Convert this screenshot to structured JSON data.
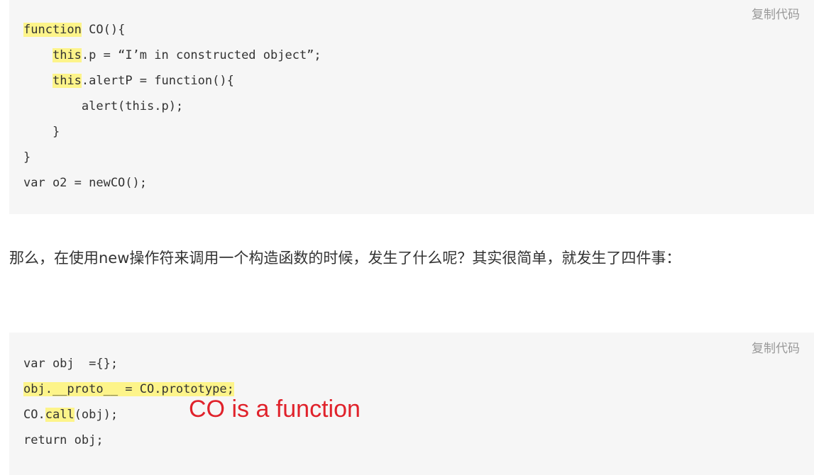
{
  "colors": {
    "highlight": "#fdf48a",
    "code_bg": "#f6f6f6",
    "annotation": "#e0222b",
    "copy_text": "#999999"
  },
  "block1": {
    "copy_label": "复制代码",
    "lines": [
      {
        "parts": [
          {
            "text": "function",
            "hl": true
          },
          {
            "text": " CO(){",
            "hl": false
          }
        ]
      },
      {
        "parts": [
          {
            "text": "    ",
            "hl": false
          },
          {
            "text": "this",
            "hl": true
          },
          {
            "text": ".p = “I’m in constructed object”;",
            "hl": false
          }
        ]
      },
      {
        "parts": [
          {
            "text": "    ",
            "hl": false
          },
          {
            "text": "this",
            "hl": true
          },
          {
            "text": ".alertP = function(){",
            "hl": false
          }
        ]
      },
      {
        "parts": [
          {
            "text": "        alert(this.p);",
            "hl": false
          }
        ]
      },
      {
        "parts": [
          {
            "text": "    }",
            "hl": false
          }
        ]
      },
      {
        "parts": [
          {
            "text": "}",
            "hl": false
          }
        ]
      },
      {
        "parts": [
          {
            "text": "var o2 = newCO();",
            "hl": false
          }
        ]
      }
    ]
  },
  "paragraph": {
    "text": "那么，在使用new操作符来调用一个构造函数的时候，发生了什么呢？其实很简单，就发生了四件事："
  },
  "block2": {
    "copy_label": "复制代码",
    "lines": [
      {
        "parts": [
          {
            "text": "var obj  ={};",
            "hl": false
          }
        ]
      },
      {
        "parts": [
          {
            "text": "obj.__proto__ = CO.prototype;",
            "hl": true
          }
        ]
      },
      {
        "parts": [
          {
            "text": "CO.",
            "hl": false
          },
          {
            "text": "call",
            "hl": true
          },
          {
            "text": "(obj);",
            "hl": false
          }
        ]
      },
      {
        "parts": [
          {
            "text": "return obj;",
            "hl": false
          }
        ]
      }
    ],
    "annotation": "CO is a function"
  }
}
